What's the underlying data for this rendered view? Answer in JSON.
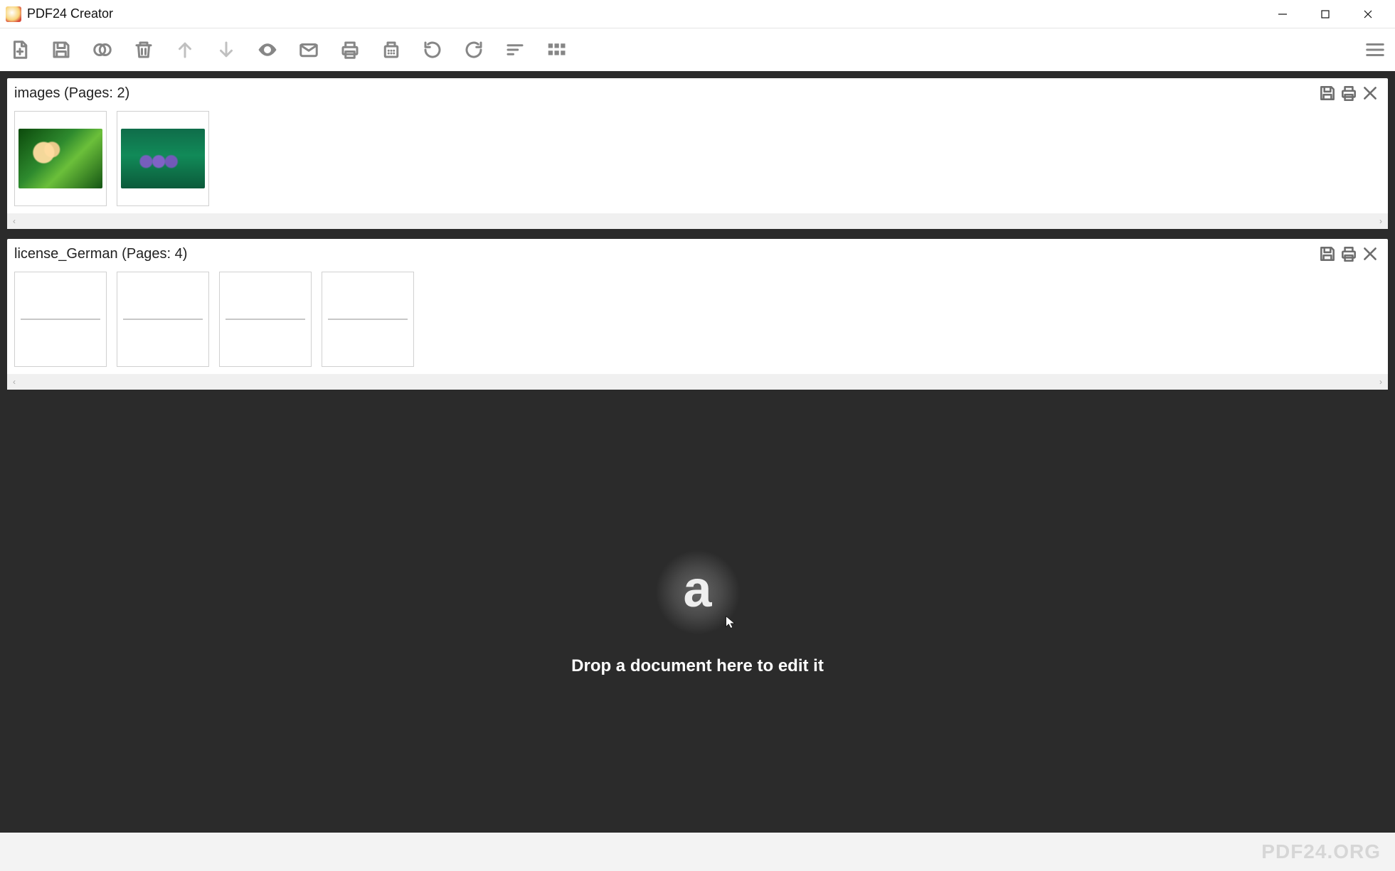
{
  "app": {
    "title": "PDF24 Creator"
  },
  "toolbar": {
    "items": [
      {
        "name": "new-file-icon"
      },
      {
        "name": "save-icon"
      },
      {
        "name": "merge-icon"
      },
      {
        "name": "delete-icon"
      },
      {
        "name": "move-up-icon",
        "disabled": true
      },
      {
        "name": "move-down-icon",
        "disabled": true
      },
      {
        "name": "preview-icon"
      },
      {
        "name": "email-icon"
      },
      {
        "name": "print-icon"
      },
      {
        "name": "fax-icon"
      },
      {
        "name": "rotate-left-icon"
      },
      {
        "name": "rotate-right-icon"
      },
      {
        "name": "sort-icon"
      },
      {
        "name": "grid-icon"
      }
    ]
  },
  "documents": [
    {
      "name": "images",
      "page_count": 2,
      "title_display": "images (Pages: 2)",
      "thumbs": [
        "image",
        "image"
      ]
    },
    {
      "name": "license_German",
      "page_count": 4,
      "title_display": "license_German (Pages: 4)",
      "thumbs": [
        "text",
        "text",
        "text",
        "text"
      ]
    }
  ],
  "doc_actions": {
    "save": "save-icon",
    "print": "print-icon",
    "close": "close-icon"
  },
  "dropzone": {
    "text": "Drop a document here to edit it"
  },
  "footer": {
    "brand": "PDF24.ORG"
  }
}
